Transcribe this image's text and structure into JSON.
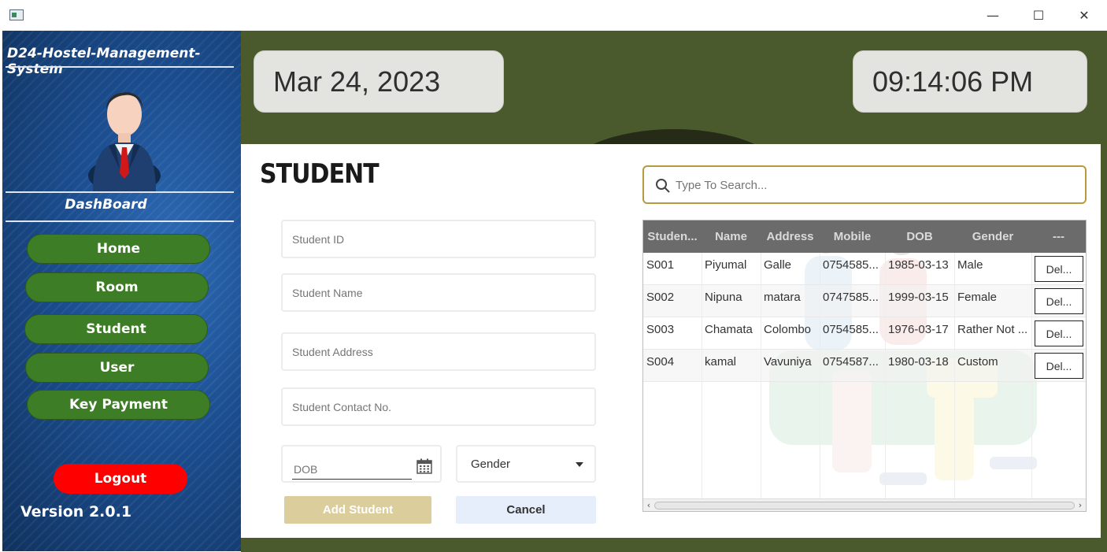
{
  "window": {
    "minimize_glyph": "—",
    "maximize_glyph": "☐",
    "close_glyph": "✕"
  },
  "sidebar": {
    "brand": "D24-Hostel-Management-System",
    "dashboard_label": "DashBoard",
    "nav": [
      {
        "label": "Home"
      },
      {
        "label": "Room"
      },
      {
        "label": "Student"
      },
      {
        "label": "User"
      },
      {
        "label": "Key Payment"
      }
    ],
    "logout_label": "Logout",
    "version": "Version 2.0.1"
  },
  "header": {
    "date": "Mar 24, 2023",
    "time": "09:14:06 PM"
  },
  "form": {
    "title": "STUDENT",
    "student_id_placeholder": "Student ID",
    "student_name_placeholder": "Student Name",
    "student_address_placeholder": "Student Address",
    "student_contact_placeholder": "Student Contact No.",
    "dob_placeholder": "DOB",
    "gender_label": "Gender",
    "add_label": "Add Student",
    "cancel_label": "Cancel"
  },
  "search": {
    "placeholder": "Type To Search..."
  },
  "table": {
    "columns": [
      "Studen...",
      "Name",
      "Address",
      "Mobile",
      "DOB",
      "Gender",
      "---"
    ],
    "rows": [
      {
        "id": "S001",
        "name": "Piyumal",
        "address": "Galle",
        "mobile": "0754585...",
        "dob": "1985-03-13",
        "gender": "Male",
        "action": "Del..."
      },
      {
        "id": "S002",
        "name": "Nipuna",
        "address": "matara",
        "mobile": "0747585...",
        "dob": "1999-03-15",
        "gender": "Female",
        "action": "Del..."
      },
      {
        "id": "S003",
        "name": "Chamata",
        "address": "Colombo",
        "mobile": "0754585...",
        "dob": "1976-03-17",
        "gender": "Rather Not ...",
        "action": "Del..."
      },
      {
        "id": "S004",
        "name": "kamal",
        "address": "Vavuniya",
        "mobile": "0754587...",
        "dob": "1980-03-18",
        "gender": "Custom",
        "action": "Del..."
      }
    ]
  },
  "colors": {
    "nav_green": "#3d7d25",
    "logout_red": "#ff0000",
    "olive_band": "#4a5a2d",
    "add_button": "#dccd9c",
    "search_border": "#b59a3e"
  }
}
